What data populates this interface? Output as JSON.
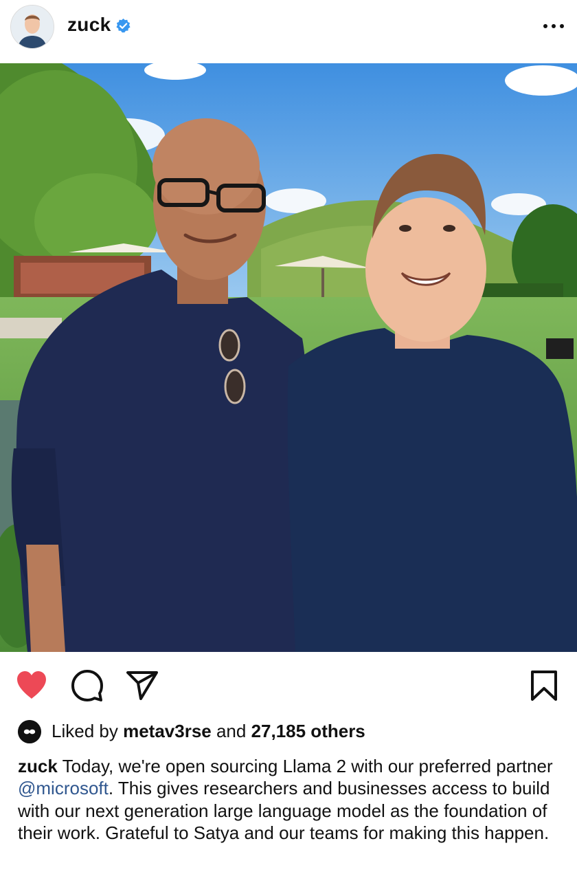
{
  "post": {
    "username": "zuck",
    "verified": true,
    "avatar_icon": "profile-photo",
    "more_icon": "more-horizontal-icon",
    "photo_description_icon": "post-photo"
  },
  "actions": {
    "liked": true,
    "like_color": "#ed4956",
    "like_icon": "heart-icon",
    "comment_icon": "comment-icon",
    "share_icon": "send-icon",
    "save_icon": "bookmark-icon"
  },
  "likes": {
    "prefix": "Liked by ",
    "liker": "metav3rse",
    "middle": " and ",
    "count": "27,185 others"
  },
  "caption": {
    "username": "zuck",
    "text_before": " Today, we're open sourcing Llama 2 with our preferred partner ",
    "mention": "@microsoft",
    "text_after": ". This gives researchers and businesses access to build with our next generation large language model as the foundation of their work. Grateful to Satya and our teams for making this happen."
  },
  "colors": {
    "verified_badge": "#3897f0",
    "mention": "#30578f",
    "text": "#111111"
  }
}
